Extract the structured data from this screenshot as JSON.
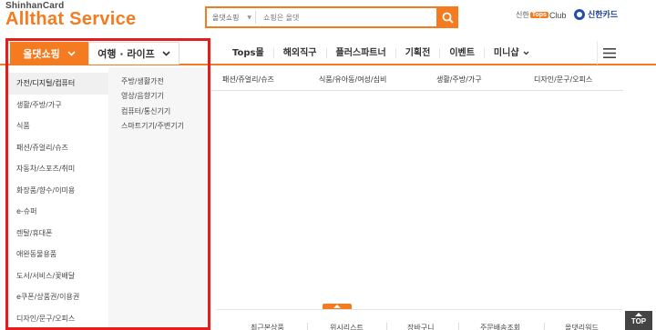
{
  "header": {
    "logo_sub": "ShinhanCard",
    "logo_main": "Allthat Service",
    "search": {
      "scope": "올댓쇼핑",
      "placeholder": "쇼핑은 올댓"
    },
    "tops_badge": "Tops",
    "tops_prefix": "신한",
    "tops_club": "Club",
    "card_brand": "신한카드"
  },
  "nav": {
    "tab_shopping": "올댓쇼핑",
    "tab_travel": "여행 · 라이프",
    "links": [
      "Tops몰",
      "해외직구",
      "플러스파트너",
      "기획전",
      "이벤트",
      "미니샵"
    ]
  },
  "categories": {
    "items": [
      "가전/디지털/컴퓨터",
      "생활/주방/가구",
      "식품",
      "패션/쥬얼리/슈즈",
      "자동차/스포츠/취미",
      "화장품/향수/이미용",
      "e-슈퍼",
      "렌탈/휴대폰",
      "애완동물용품",
      "도서/서비스/꽃배달",
      "e쿠폰/상품권/이용권",
      "디자인/문구/오피스"
    ],
    "sub_items": [
      "주방/생활가전",
      "영상/음향기기",
      "컴퓨터/통신기기",
      "스마트기기/주변기기"
    ]
  },
  "mega_headers": [
    "패션/쥬얼리/슈즈",
    "식품/유아동/여성/심비",
    "생활/주방/가구",
    "디자인/문구/오피스"
  ],
  "quick_bar": [
    "최근본상품",
    "위시리스트",
    "장바구니",
    "주문배송조회",
    "올댓리워드"
  ],
  "top_button": "TOP",
  "colors": {
    "accent": "#f47b20",
    "highlight": "#e41e1e"
  }
}
